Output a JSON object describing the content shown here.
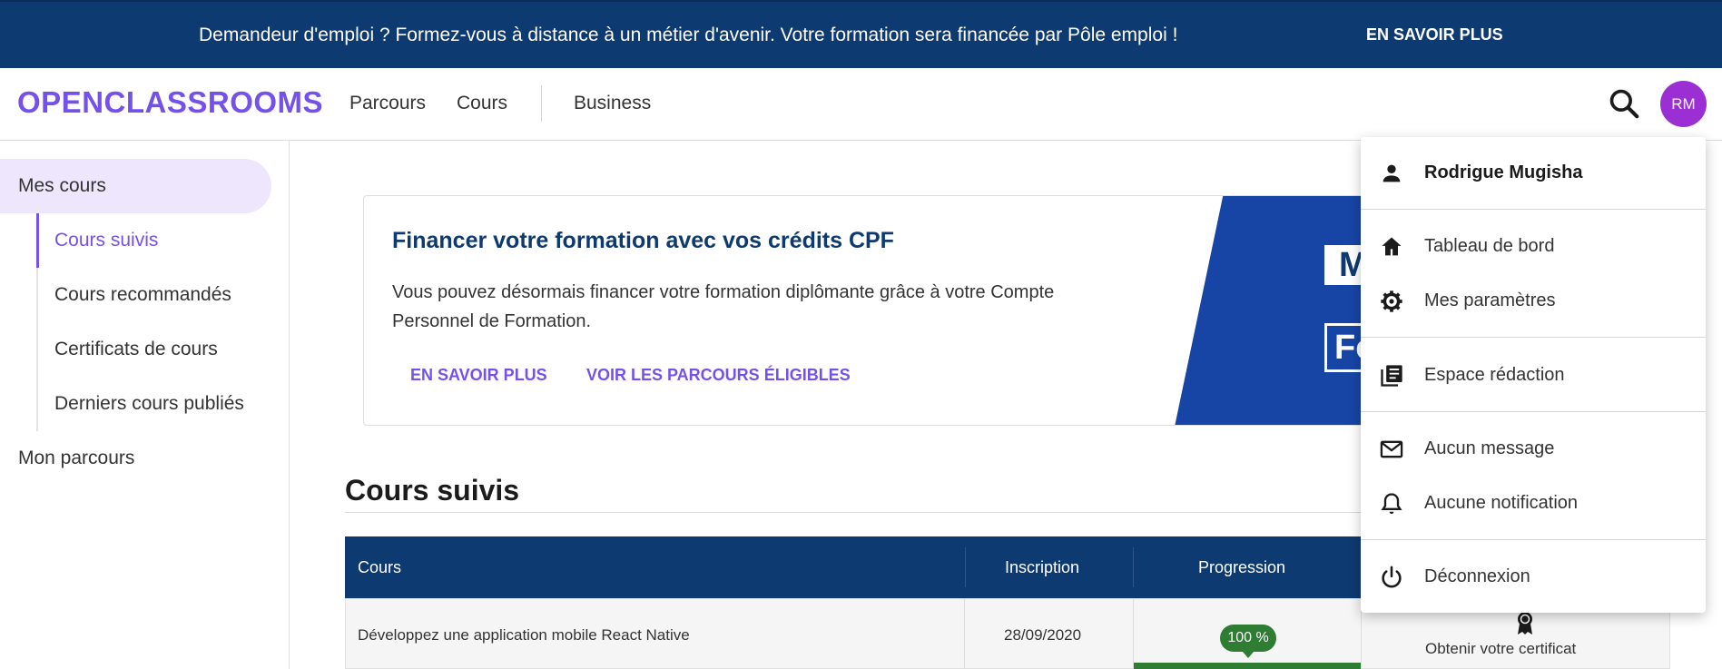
{
  "banner": {
    "text": "Demandeur d'emploi ? Formez-vous à distance à un métier d'avenir. Votre formation sera financée par Pôle emploi !",
    "link_label": "EN SAVOIR PLUS"
  },
  "header": {
    "logo": "OPENCLASSROOMS",
    "nav": [
      "Parcours",
      "Cours",
      "Business"
    ],
    "avatar_initials": "RM"
  },
  "sidebar": {
    "mes_cours": "Mes cours",
    "sub_items": [
      "Cours suivis",
      "Cours recommandés",
      "Certificats de cours",
      "Derniers cours publiés"
    ],
    "mon_parcours": "Mon parcours"
  },
  "cpf": {
    "title": "Financer votre formation avec vos crédits CPF",
    "description": "Vous pouvez désormais financer votre formation diplômante grâce à votre Compte Personnel de Formation.",
    "link_more": "EN SAVOIR PLUS",
    "link_eligible": "VOIR LES PARCOURS ÉLIGIBLES",
    "visual_text_1": "M",
    "visual_text_2": "Fo"
  },
  "section": {
    "title": "Cours suivis"
  },
  "table": {
    "headers": [
      "Cours",
      "Inscription",
      "Progression"
    ],
    "rows": [
      {
        "course": "Développez une application mobile React Native",
        "date": "28/09/2020",
        "progress_label": "100 %",
        "progress": 1.0,
        "certificate": "Obtenir votre certificat"
      }
    ]
  },
  "dropdown": {
    "user_name": "Rodrigue Mugisha",
    "items": [
      "Tableau de bord",
      "Mes paramètres",
      "Espace rédaction",
      "Aucun message",
      "Aucune notification",
      "Déconnexion"
    ]
  },
  "colors": {
    "brand_purple": "#7451eb",
    "navy": "#0e3a72",
    "success_green": "#2e7d32",
    "avatar": "#9c2fd3"
  }
}
